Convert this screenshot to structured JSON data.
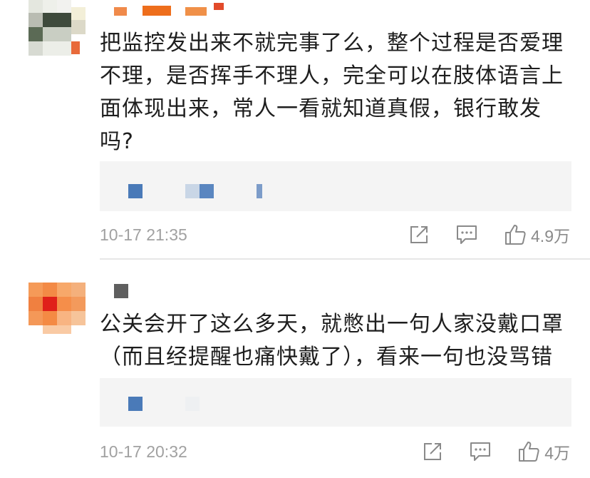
{
  "comments": [
    {
      "text": "把监控发出来不就完事了么，整个过程是否爱理不理，是否挥手不理人，完全可以在肢体语言上面体现出来，常人一看就知道真假，银行敢发吗?",
      "time": "10-17 21:35",
      "likes": "4.9万"
    },
    {
      "text": "公关会开了这么多天，就憋出一句人家没戴口罩（而且经提醒也痛快戴了），看来一句也没骂错",
      "time": "10-17 20:32",
      "likes": "4万"
    }
  ],
  "icons": {
    "share": "share-icon",
    "reply": "comment-icon",
    "like": "thumbs-up-icon"
  },
  "colors": {
    "text": "#1e1e1e",
    "meta": "#a1a1a1",
    "reply_bg": "#f4f4f4",
    "icon": "#8a8a8a"
  }
}
